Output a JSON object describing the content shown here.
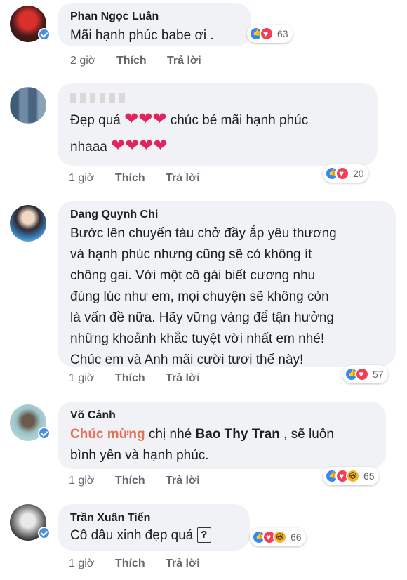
{
  "comments": [
    {
      "author": "Phan Ngọc Luân",
      "text": "Mãi hạnh phúc babe ơi .",
      "reaction_count": "63",
      "time": "2 giờ",
      "like_label": "Thích",
      "reply_label": "Trả lời"
    },
    {
      "author": "",
      "text_a": "Đẹp quá",
      "text_b": "chúc bé mãi hạnh phúc",
      "text_c": "nhaaa",
      "hearts_line1": "❤❤❤",
      "hearts_line2": "❤❤❤❤",
      "reaction_count": "20",
      "time": "1 giờ",
      "like_label": "Thích",
      "reply_label": "Trả lời"
    },
    {
      "author": "Dang Quynh Chi",
      "lines": [
        "Bước lên chuyến tàu chở đầy ắp yêu thương",
        "và hạnh phúc nhưng cũng sẽ có không ít",
        "chông gai. Với một cô gái biết cương nhu",
        "đúng lúc như em, mọi chuyện sẽ không còn",
        "là vấn đề nữa. Hãy vững vàng để tận hưởng",
        "những khoảnh khắc tuyệt vời nhất em nhé!",
        "Chúc em và Anh mãi cười tươi thế này!"
      ],
      "reaction_count": "57",
      "time": "1 giờ",
      "like_label": "Thích",
      "reply_label": "Trả lời"
    },
    {
      "author": "Võ Cảnh",
      "mention1": "Chúc mừng",
      "text_mid": " chị nhé ",
      "mention2": "Bao Thy Tran",
      "text_end": " , sẽ luôn",
      "line2": "bình yên và hạnh phúc.",
      "reaction_count": "65",
      "time": "1 giờ",
      "like_label": "Thích",
      "reply_label": "Trả lời"
    },
    {
      "author": "Trần Xuân Tiến",
      "text": "Cô dâu xinh đẹp quá",
      "unknown_glyph": "?",
      "reaction_count": "66",
      "time": "1 giờ",
      "like_label": "Thích",
      "reply_label": "Trả lời"
    }
  ],
  "colors": {
    "bubble": "#f0f2f5",
    "like": "#2e89ff",
    "love": "#f33e58",
    "haha": "#f7b125",
    "mention": "#e2735a",
    "meta": "#65676b"
  }
}
